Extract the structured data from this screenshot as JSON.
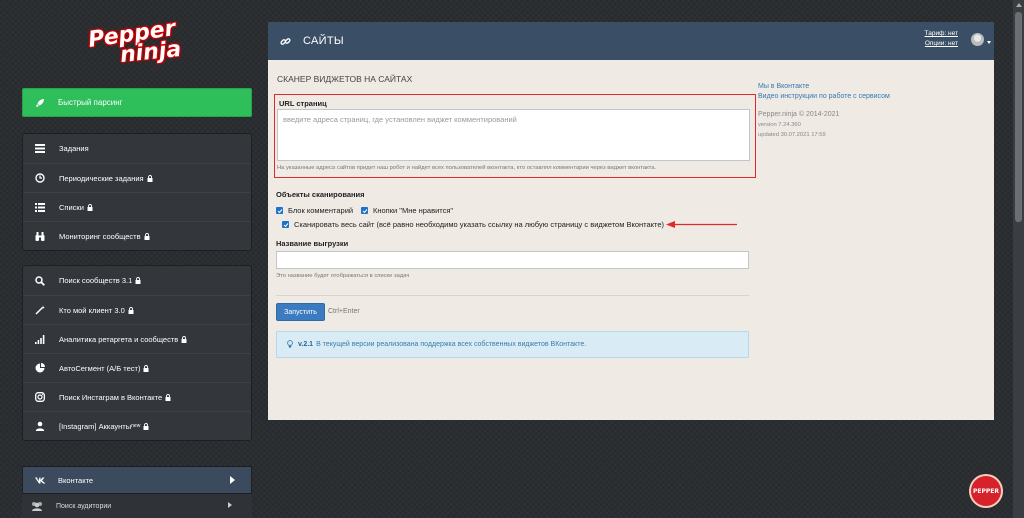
{
  "logo": {
    "line1": "Pepper",
    "line2": "ninja"
  },
  "sidebar": {
    "quick": {
      "label": "Быстрый парсинг",
      "icon": "rocket-icon",
      "color": "#2ebf5b"
    },
    "group1": [
      {
        "label": "Задания",
        "icon": "tasks-icon",
        "locked": false
      },
      {
        "label": "Периодические задания",
        "icon": "clock-icon",
        "locked": true
      },
      {
        "label": "Списки",
        "icon": "list-icon",
        "locked": true
      },
      {
        "label": "Мониторинг сообществ",
        "icon": "binoculars-icon",
        "locked": true
      }
    ],
    "group2": [
      {
        "label": "Поиск сообществ 3.1",
        "icon": "search-icon",
        "locked": true
      },
      {
        "label": "Кто мой клиент 3.0",
        "icon": "magic-wand-icon",
        "locked": true
      },
      {
        "label": "Аналитика ретаргета и сообществ",
        "icon": "signal-bars-icon",
        "locked": true
      },
      {
        "label": "АвтоСегмент (А/Б тест)",
        "icon": "pie-chart-icon",
        "locked": true
      },
      {
        "label": "Поиск Инстаграм в Вконтакте",
        "icon": "instagram-icon",
        "locked": true
      },
      {
        "label": "[Instagram] Аккаунты",
        "sup": "new",
        "icon": "user-icon",
        "locked": true
      }
    ],
    "vk": {
      "label": "Вконтакте",
      "icon": "vk-icon"
    },
    "sub": {
      "label": "Поиск аудитории",
      "icon": "users-icon"
    }
  },
  "header": {
    "title": "САЙТЫ",
    "icon": "link-icon",
    "tariff": "Тариф: нет",
    "options": "Опции: нет",
    "color": "#3a4f65"
  },
  "main": {
    "section_title": "СКАНЕР ВИДЖЕТОВ НА САЙТАХ",
    "url_label": "URL страниц",
    "url_placeholder": "введите адреса страниц, где установлен виджет комментирований",
    "url_value": "",
    "url_help": "На указанные адреса сайтов придет наш робот и найдет всех пользователей вконтакта, кто оставлял комментарии через виджет вконтакта.",
    "scan_title": "Объекты сканирования",
    "checkboxes": [
      {
        "label": "Блок комментарий",
        "checked": true
      },
      {
        "label": "Кнопки \"Мне нравится\"",
        "checked": true
      },
      {
        "label": "Сканировать весь сайт (всё равно необходимо указать ссылку на любую страницу с виджетом Вконтакте)",
        "checked": true
      }
    ],
    "export_label": "Название выгрузки",
    "export_value": "",
    "export_help": "Это название будет отображаться в списке задач",
    "run_label": "Запустить",
    "hotkey": "Ctrl+Enter",
    "alert_version": "v.2.1",
    "alert_text": "В текущей версии реализована поддержка всех собственных виджетов ВКонтакте."
  },
  "side": {
    "link1": "Мы в Вконтакте",
    "link2": "Видео инструкции по работе с сервисом",
    "copyright": "Pepper.ninja © 2014-2021",
    "version": "version 7.24.360",
    "updated": "updated 30.07.2021 17:59"
  },
  "badge": {
    "label": "PEPPER"
  },
  "colors": {
    "accent_red": "#e02a2a",
    "link": "#3679b5",
    "button_blue": "#3b7bbf"
  }
}
